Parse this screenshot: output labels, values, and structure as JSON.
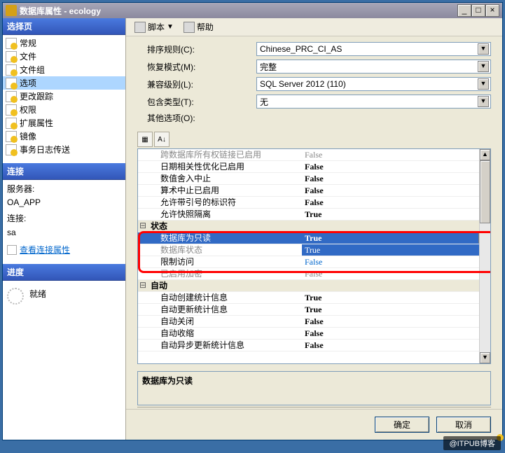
{
  "window": {
    "title": "数据库属性 - ecology"
  },
  "controls": {
    "min": "_",
    "max": "□",
    "close": "×"
  },
  "left": {
    "select_head": "选择页",
    "tree": [
      {
        "label": "常规"
      },
      {
        "label": "文件"
      },
      {
        "label": "文件组"
      },
      {
        "label": "选项",
        "sel": true
      },
      {
        "label": "更改跟踪"
      },
      {
        "label": "权限"
      },
      {
        "label": "扩展属性"
      },
      {
        "label": "镜像"
      },
      {
        "label": "事务日志传送"
      }
    ],
    "conn_head": "连接",
    "server_lbl": "服务器:",
    "server_val": "OA_APP",
    "conn_lbl": "连接:",
    "conn_val": "sa",
    "view_link": "查看连接属性",
    "prog_head": "进度",
    "prog_val": "就绪"
  },
  "toolbar": {
    "script": "脚本",
    "help": "帮助",
    "drop": "▼"
  },
  "form": {
    "collation_lbl": "排序规则(C):",
    "collation_val": "Chinese_PRC_CI_AS",
    "recovery_lbl": "恢复模式(M):",
    "recovery_val": "完整",
    "compat_lbl": "兼容级别(L):",
    "compat_val": "SQL Server 2012 (110)",
    "contain_lbl": "包含类型(T):",
    "contain_val": "无",
    "other_lbl": "其他选项(O):"
  },
  "gridtoolbar": {
    "b1": "▦",
    "b2": "A↓"
  },
  "grid": {
    "rows": [
      {
        "t": "item",
        "n": "跨数据库所有权链接已启用",
        "v": "False",
        "disabled": true
      },
      {
        "t": "item",
        "n": "日期相关性优化已启用",
        "v": "False"
      },
      {
        "t": "item",
        "n": "数值舍入中止",
        "v": "False"
      },
      {
        "t": "item",
        "n": "算术中止已启用",
        "v": "False"
      },
      {
        "t": "item",
        "n": "允许带引号的标识符",
        "v": "False"
      },
      {
        "t": "item",
        "n": "允许快照隔离",
        "v": "True"
      },
      {
        "t": "group",
        "n": "状态"
      },
      {
        "t": "item",
        "n": "数据库为只读",
        "v": "True",
        "selname": true,
        "dd": true
      },
      {
        "t": "item",
        "n": "数据库状态",
        "v": "True",
        "disabled": true,
        "selval": true
      },
      {
        "t": "item",
        "n": "限制访问",
        "v": "False",
        "hot": true
      },
      {
        "t": "item",
        "n": "已启用加密",
        "v": "False",
        "disabled": true
      },
      {
        "t": "group",
        "n": "自动"
      },
      {
        "t": "item",
        "n": "自动创建统计信息",
        "v": "True"
      },
      {
        "t": "item",
        "n": "自动更新统计信息",
        "v": "True"
      },
      {
        "t": "item",
        "n": "自动关闭",
        "v": "False"
      },
      {
        "t": "item",
        "n": "自动收缩",
        "v": "False"
      },
      {
        "t": "item",
        "n": "自动异步更新统计信息",
        "v": "False"
      }
    ]
  },
  "desc": {
    "title": "数据库为只读"
  },
  "buttons": {
    "ok": "确定",
    "cancel": "取消"
  },
  "watermark": "@ITPUB博客"
}
